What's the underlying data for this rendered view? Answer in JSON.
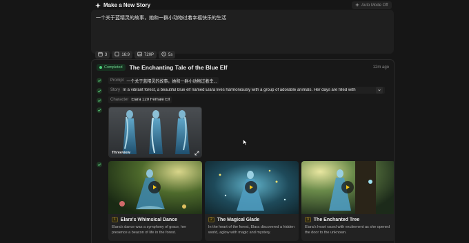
{
  "header": {
    "title": "Make a New Story",
    "auto_mode_label": "Auto Mode Off"
  },
  "composer": {
    "prompt": "一个关于蓝精灵的故事，她和一群小动物过着幸福快乐的生活",
    "options": [
      {
        "icon": "calendar-icon",
        "label": "3"
      },
      {
        "icon": "aspect-ratio-icon",
        "label": "16:9"
      },
      {
        "icon": "image-icon",
        "label": "720P"
      },
      {
        "icon": "clock-icon",
        "label": "5s"
      }
    ]
  },
  "story": {
    "status": "Completed",
    "title": "The Enchanting Tale of the Blue Elf",
    "time_ago": "12m ago",
    "prompt_label": "Prompt",
    "prompt_value": "一个关于蓝精灵的故事，她和一群小动物过着幸...",
    "story_label": "Story",
    "story_value": "In a vibrant forest, a beautiful blue elf named Elara lives harmoniously with a group of adorable animals. Her days are filled with",
    "character_label": "Character",
    "character_value": "Elara 120 Female Elf",
    "threeview_label": "Threeview"
  },
  "scenes": [
    {
      "num": "1",
      "title": "Elara's Whimsical Dance",
      "desc": "Elara's dance was a symphony of grace, her presence a beacon of life in the forest."
    },
    {
      "num": "2",
      "title": "The Magical Glade",
      "desc": "In the heart of the forest, Elara discovered a hidden world, aglow with magic and mystery."
    },
    {
      "num": "3",
      "title": "The Enchanted Tree",
      "desc": "Elara's heart raced with excitement as she opened the door to the unknown."
    }
  ],
  "colors": {
    "accent": "#f5c518",
    "success": "#4ed07a",
    "background": "#161616"
  }
}
